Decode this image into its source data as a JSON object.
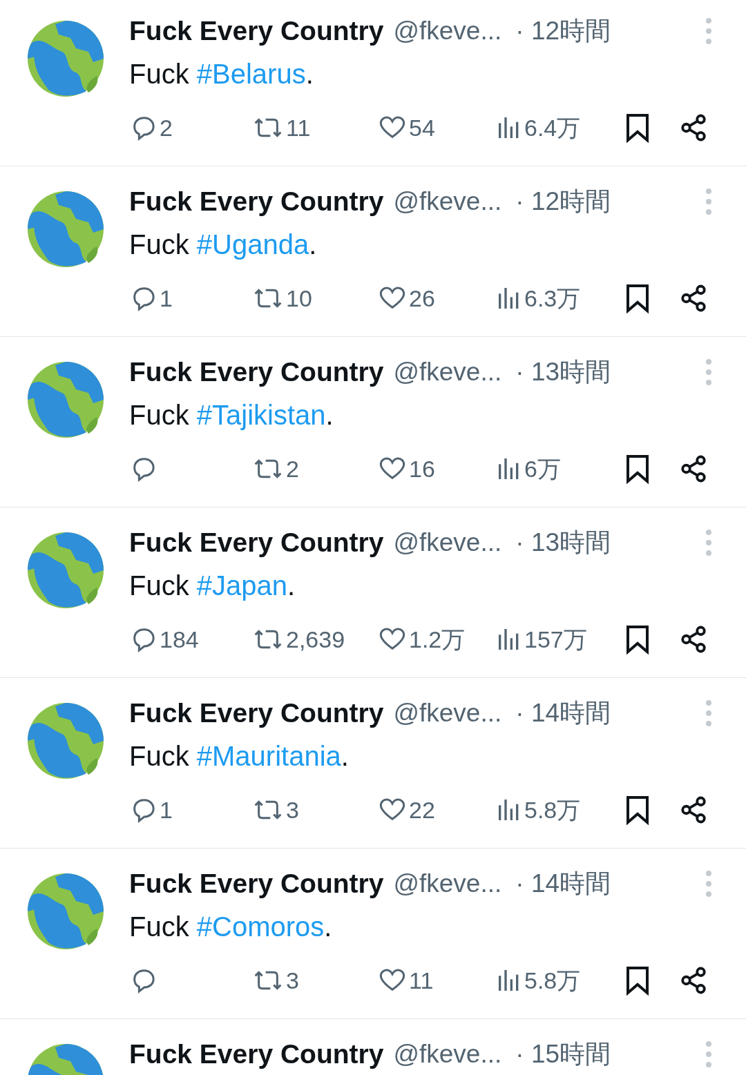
{
  "tweets": [
    {
      "name": "Fuck Every Country",
      "handle": "@fkeve...",
      "time": "· 12時間",
      "text": "Fuck ",
      "hashtag": "#Belarus",
      "end": ".",
      "stats": {
        "replies": "2",
        "reposts": "11",
        "likes": "54",
        "views": "6.4万"
      }
    },
    {
      "name": "Fuck Every Country",
      "handle": "@fkeve...",
      "time": "· 12時間",
      "text": "Fuck ",
      "hashtag": "#Uganda",
      "end": ".",
      "stats": {
        "replies": "1",
        "reposts": "10",
        "likes": "26",
        "views": "6.3万"
      }
    },
    {
      "name": "Fuck Every Country",
      "handle": "@fkeve...",
      "time": "· 13時間",
      "text": "Fuck ",
      "hashtag": "#Tajikistan",
      "end": ".",
      "stats": {
        "reposts": "2",
        "likes": "16",
        "views": "6万"
      }
    },
    {
      "name": "Fuck Every Country",
      "handle": "@fkeve...",
      "time": "· 13時間",
      "text": "Fuck ",
      "hashtag": "#Japan",
      "end": ".",
      "stats": {
        "replies": "184",
        "reposts": "2,639",
        "likes": "1.2万",
        "views": "157万"
      }
    },
    {
      "name": "Fuck Every Country",
      "handle": "@fkeve...",
      "time": "· 14時間",
      "text": "Fuck ",
      "hashtag": "#Mauritania",
      "end": ".",
      "stats": {
        "replies": "1",
        "reposts": "3",
        "likes": "22",
        "views": "5.8万"
      }
    },
    {
      "name": "Fuck Every Country",
      "handle": "@fkeve...",
      "time": "· 14時間",
      "text": "Fuck ",
      "hashtag": "#Comoros",
      "end": ".",
      "stats": {
        "reposts": "3",
        "likes": "11",
        "views": "5.8万"
      }
    },
    {
      "name": "Fuck Every Country",
      "handle": "@fkeve...",
      "time": "· 15時間"
    }
  ]
}
